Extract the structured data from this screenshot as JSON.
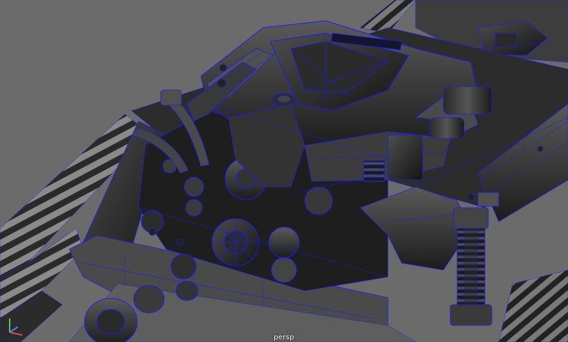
{
  "viewport": {
    "camera_name": "persp",
    "background_color": "#6b6b6b",
    "wireframe_color": "#1a1aff",
    "shade_color": "#3a3a3a"
  },
  "axis_gizmo": {
    "x_label": "x",
    "y_label": "y",
    "z_label": "z",
    "x_color": "#e05050",
    "y_color": "#60c060",
    "z_color": "#5080ff"
  }
}
